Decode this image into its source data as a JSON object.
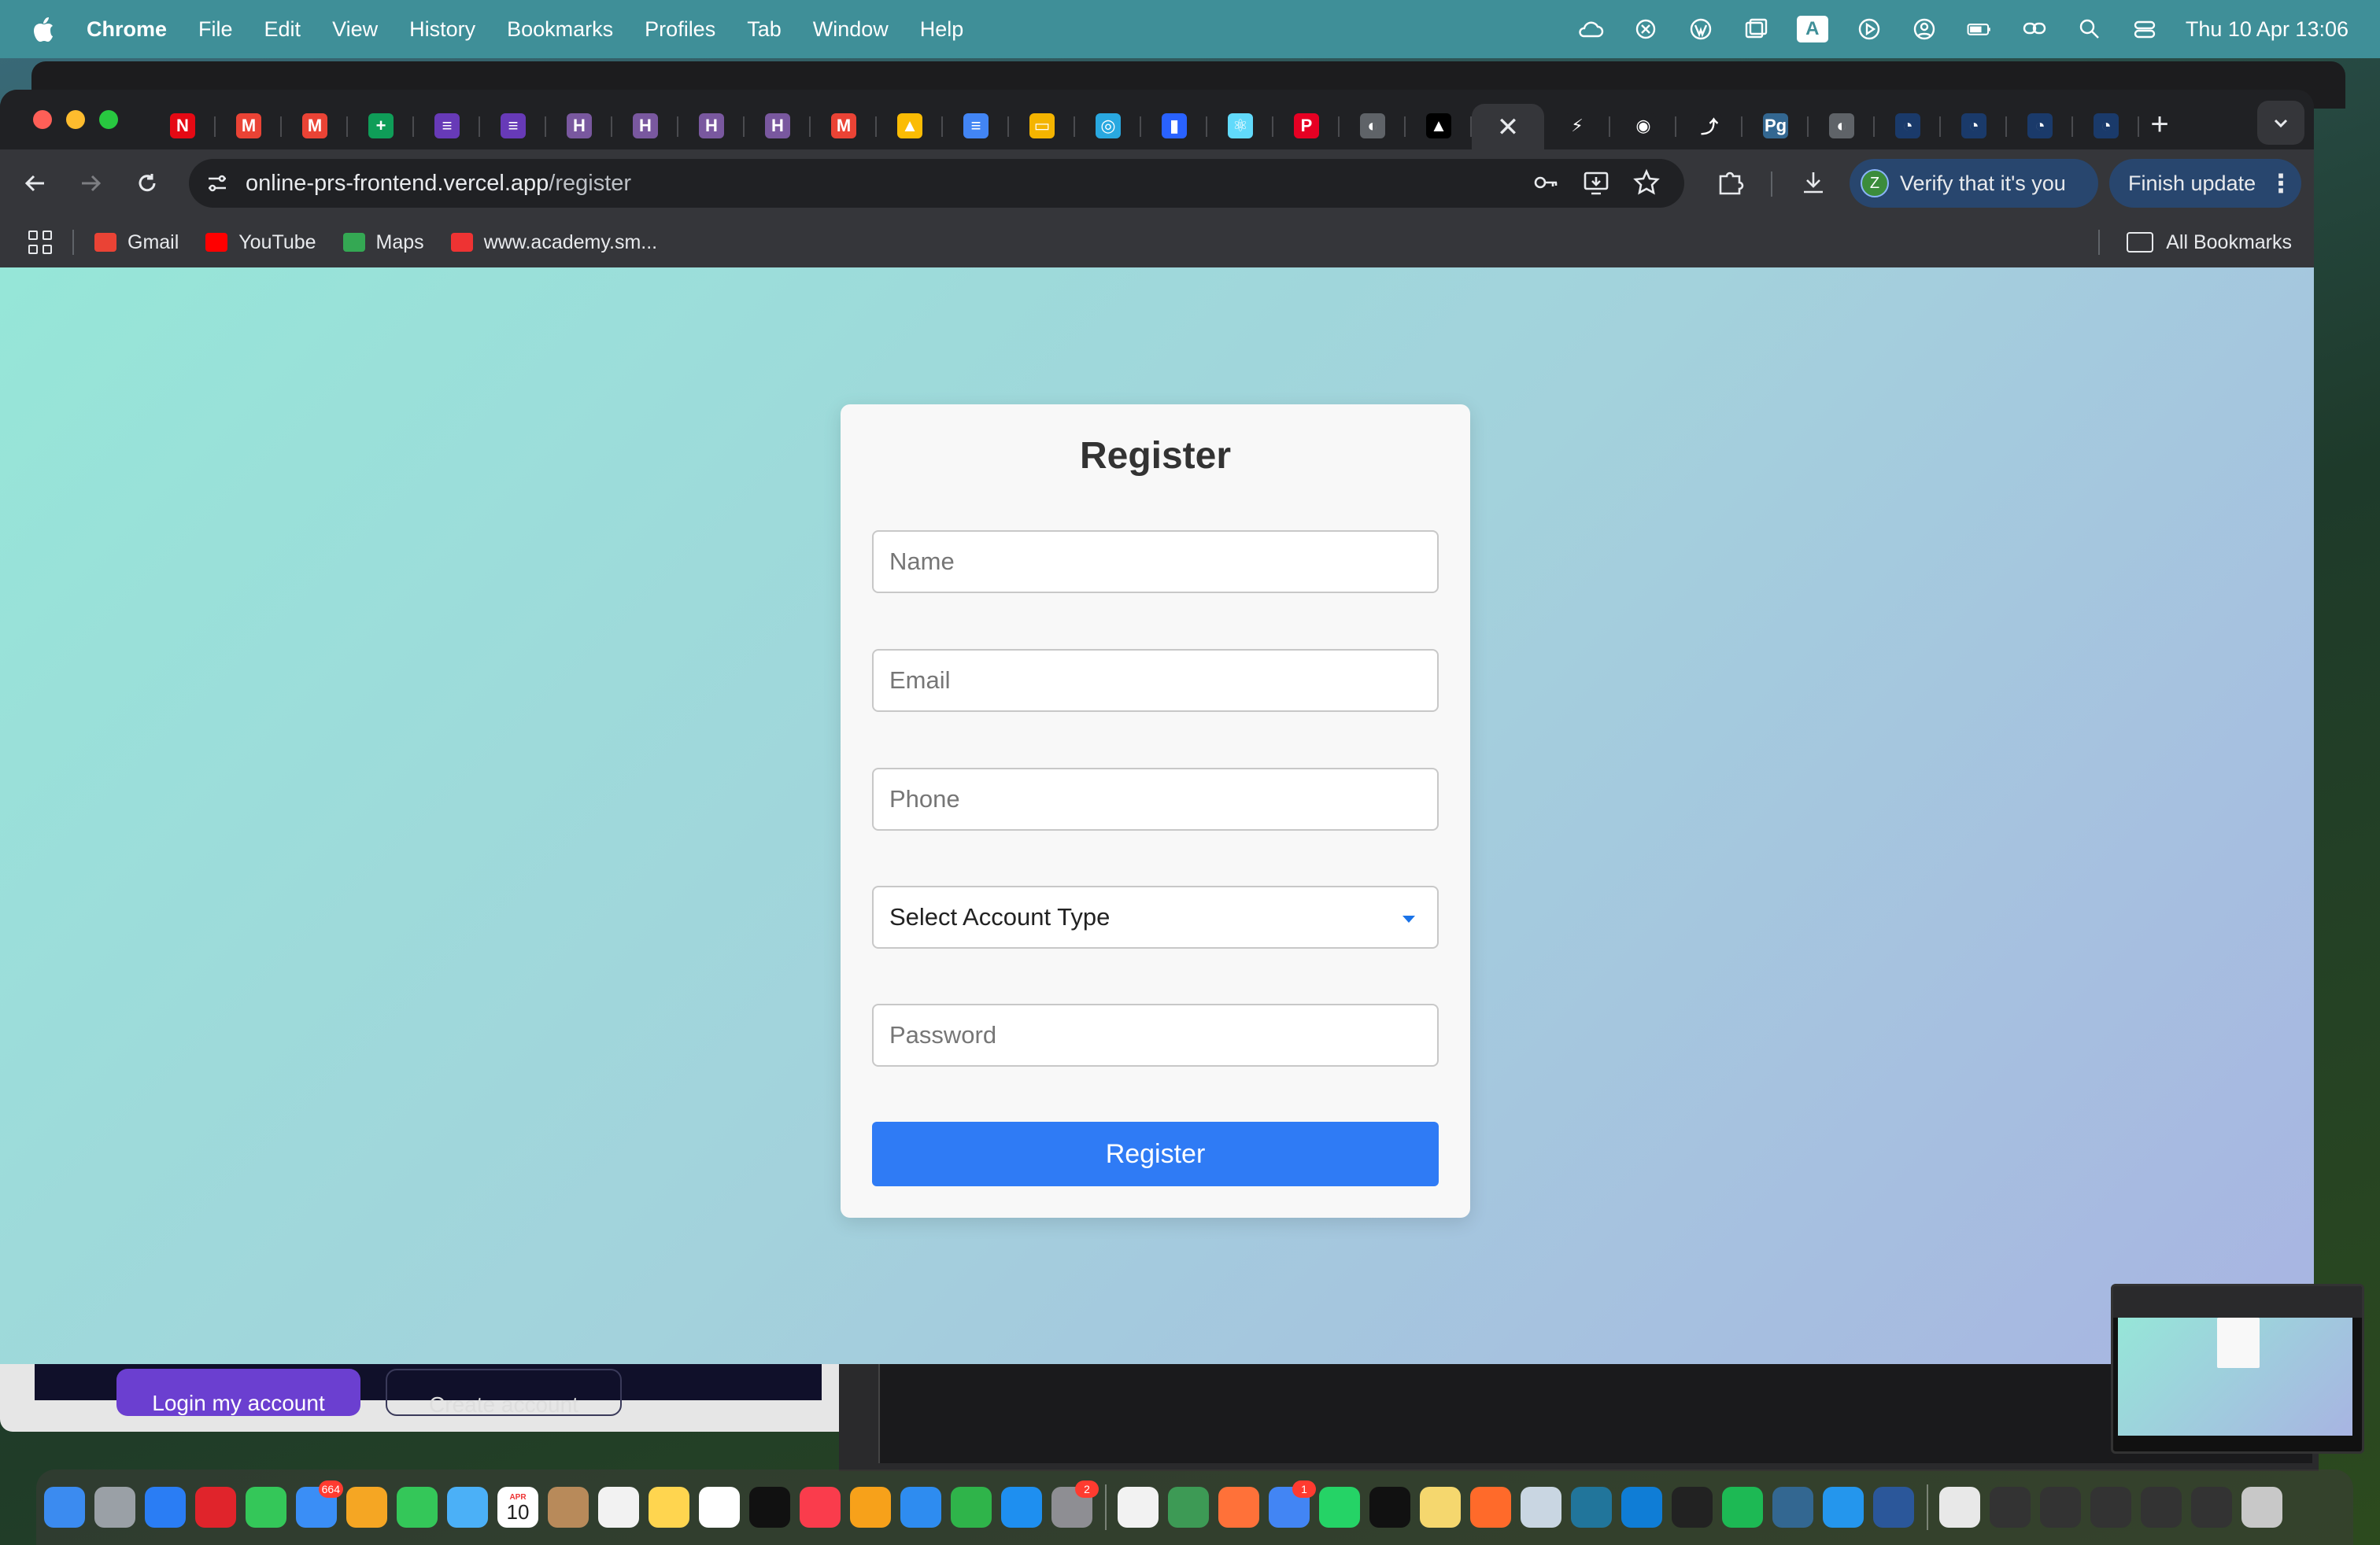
{
  "menubar": {
    "app_name": "Chrome",
    "items": [
      "File",
      "Edit",
      "View",
      "History",
      "Bookmarks",
      "Profiles",
      "Tab",
      "Window",
      "Help"
    ],
    "input_source": "A",
    "clock": "Thu 10 Apr  13:06"
  },
  "browser": {
    "url_host": "online-prs-frontend.vercel.app",
    "url_path": "/register",
    "verify_label": "Verify that it's you",
    "verify_avatar": "Z",
    "finish_update_label": "Finish update",
    "tabs": [
      {
        "icon": "netflix-icon",
        "color": "#e50914",
        "glyph": "N"
      },
      {
        "icon": "gmail-icon",
        "color": "#ea4335",
        "glyph": "M"
      },
      {
        "icon": "gmail-icon",
        "color": "#ea4335",
        "glyph": "M"
      },
      {
        "icon": "google-sheets-icon",
        "color": "#0f9d58",
        "glyph": "+"
      },
      {
        "icon": "google-forms-icon",
        "color": "#673ab7",
        "glyph": "≡"
      },
      {
        "icon": "google-forms-icon",
        "color": "#673ab7",
        "glyph": "≡"
      },
      {
        "icon": "heroku-icon",
        "color": "#79589f",
        "glyph": "H"
      },
      {
        "icon": "heroku-icon",
        "color": "#79589f",
        "glyph": "H"
      },
      {
        "icon": "heroku-icon",
        "color": "#79589f",
        "glyph": "H"
      },
      {
        "icon": "heroku-icon",
        "color": "#79589f",
        "glyph": "H"
      },
      {
        "icon": "gmail-icon",
        "color": "#ea4335",
        "glyph": "M"
      },
      {
        "icon": "google-drive-icon",
        "color": "#fbbc04",
        "glyph": "▲"
      },
      {
        "icon": "google-docs-icon",
        "color": "#4285f4",
        "glyph": "≡"
      },
      {
        "icon": "google-slides-icon",
        "color": "#f4b400",
        "glyph": "▭"
      },
      {
        "icon": "app-icon",
        "color": "#29a8e0",
        "glyph": "◎"
      },
      {
        "icon": "chart-icon",
        "color": "#2962ff",
        "glyph": "▮"
      },
      {
        "icon": "react-icon",
        "color": "#61dafb",
        "glyph": "⚛"
      },
      {
        "icon": "pinterest-icon",
        "color": "#e60023",
        "glyph": "P"
      },
      {
        "icon": "globe-icon",
        "color": "#5f6368",
        "glyph": "◐"
      },
      {
        "icon": "vercel-icon",
        "color": "#000000",
        "glyph": "▲"
      },
      {
        "icon": "close-icon",
        "color": "#35363a",
        "glyph": "✕",
        "active": true
      },
      {
        "icon": "bolt-icon",
        "color": "#202124",
        "glyph": "⚡"
      },
      {
        "icon": "github-icon",
        "color": "#202124",
        "glyph": "◉"
      },
      {
        "icon": "link-icon",
        "color": "#202124",
        "glyph": "⤴"
      },
      {
        "icon": "pgadmin-icon",
        "color": "#336791",
        "glyph": "Pg"
      },
      {
        "icon": "globe-icon",
        "color": "#5f6368",
        "glyph": "◐"
      },
      {
        "icon": "cloud-icon",
        "color": "#1a3a6a",
        "glyph": "◔"
      },
      {
        "icon": "cloud-icon",
        "color": "#1a3a6a",
        "glyph": "◔"
      },
      {
        "icon": "cloud-icon",
        "color": "#1a3a6a",
        "glyph": "◔"
      },
      {
        "icon": "cloud-icon",
        "color": "#1a3a6a",
        "glyph": "◔"
      }
    ],
    "bookmarks": [
      {
        "label": "Gmail",
        "icon": "gmail-icon",
        "color": "#ea4335"
      },
      {
        "label": "YouTube",
        "icon": "youtube-icon",
        "color": "#ff0000"
      },
      {
        "label": "Maps",
        "icon": "maps-icon",
        "color": "#34a853"
      },
      {
        "label": "www.academy.sm...",
        "icon": "academy-icon",
        "color": "#e33"
      }
    ],
    "all_bookmarks_label": "All Bookmarks"
  },
  "page": {
    "title": "Register",
    "name_placeholder": "Name",
    "email_placeholder": "Email",
    "phone_placeholder": "Phone",
    "account_type_label": "Select Account Type",
    "password_placeholder": "Password",
    "submit_label": "Register"
  },
  "background_window": {
    "primary_button": "Login my account",
    "secondary_button": "Create account"
  },
  "dock": {
    "calendar_month": "APR",
    "calendar_day": "10",
    "mail_badge": "664",
    "settings_badge": "2",
    "chrome_badge": "1"
  }
}
